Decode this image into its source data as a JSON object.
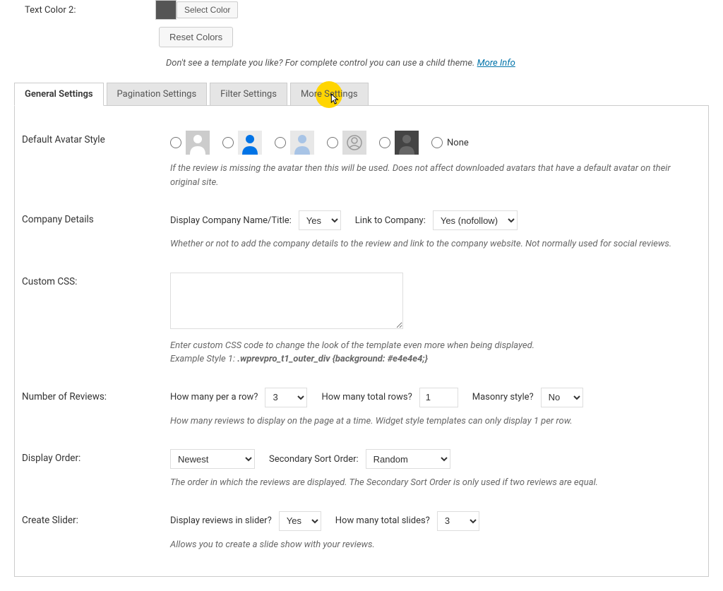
{
  "top": {
    "text_color_label": "Text Color 2:",
    "select_color": "Select Color",
    "reset_colors": "Reset Colors",
    "note_text": "Don't see a template you like? For complete control you can use a child theme. ",
    "more_info": "More Info"
  },
  "tabs": [
    {
      "label": "General Settings"
    },
    {
      "label": "Pagination Settings"
    },
    {
      "label": "Filter Settings"
    },
    {
      "label": "More Settings"
    }
  ],
  "avatar": {
    "heading": "Default Avatar Style",
    "none_label": "None",
    "description": "If the review is missing the avatar then this will be used. Does not affect downloaded avatars that have a default avatar on their original site."
  },
  "company": {
    "heading": "Company Details",
    "display_label": "Display Company Name/Title:",
    "display_value": "Yes",
    "link_label": "Link to Company:",
    "link_value": "Yes (nofollow)",
    "description": "Whether or not to add the company details to the review and link to the company website. Not normally used for social reviews."
  },
  "custom_css": {
    "heading": "Custom CSS:",
    "value": "",
    "description": "Enter custom CSS code to change the look of the template even more when being displayed.",
    "example_prefix": "Example Style 1: ",
    "example_code": ".wprevpro_t1_outer_div {background: #e4e4e4;}"
  },
  "num_reviews": {
    "heading": "Number of Reviews:",
    "per_row_label": "How many per a row?",
    "per_row_value": "3",
    "total_rows_label": "How many total rows?",
    "total_rows_value": "1",
    "masonry_label": "Masonry style?",
    "masonry_value": "No",
    "description": "How many reviews to display on the page at a time. Widget style templates can only display 1 per row."
  },
  "display_order": {
    "heading": "Display Order:",
    "primary_value": "Newest",
    "secondary_label": "Secondary Sort Order:",
    "secondary_value": "Random",
    "description": "The order in which the reviews are displayed. The Secondary Sort Order is only used if two reviews are equal."
  },
  "create_slider": {
    "heading": "Create Slider:",
    "display_label": "Display reviews in slider?",
    "display_value": "Yes",
    "total_label": "How many total slides?",
    "total_value": "3",
    "description": "Allows you to create a slide show with your reviews."
  }
}
